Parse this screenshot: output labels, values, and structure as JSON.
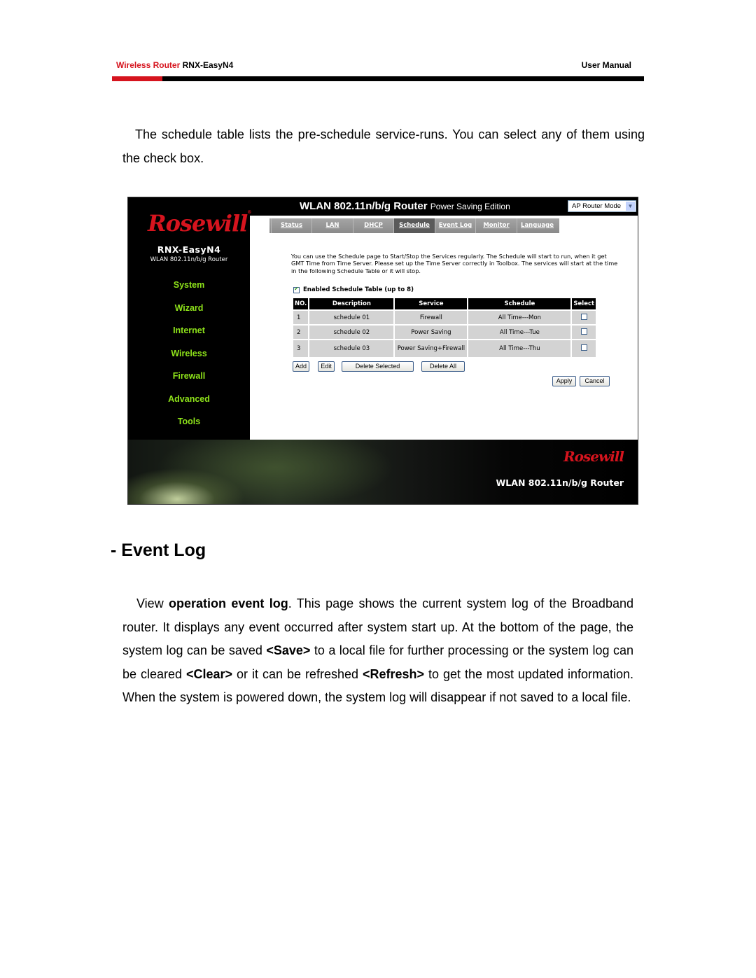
{
  "header": {
    "product_label": "Wireless Router",
    "model": "RNX-EasyN4",
    "doc_type": "User Manual",
    "accent_color": "#d6141e"
  },
  "intro_paragraph": "The schedule table lists the pre-schedule service-runs. You can select any of them using the check box.",
  "router_ui": {
    "title_main": "WLAN 802.11n/b/g Router",
    "title_sub": "Power Saving Edition",
    "mode_select": {
      "selected": "AP Router Mode"
    },
    "brand": "Rosewill",
    "model_name": "RNX-EasyN4",
    "model_desc": "WLAN 802.11n/b/g Router",
    "nav_color": "#8ee31a",
    "sidebar": [
      {
        "label": "System"
      },
      {
        "label": "Wizard"
      },
      {
        "label": "Internet"
      },
      {
        "label": "Wireless"
      },
      {
        "label": "Firewall"
      },
      {
        "label": "Advanced"
      },
      {
        "label": "Tools"
      }
    ],
    "tabs": [
      {
        "label": "Status",
        "active": false
      },
      {
        "label": "LAN",
        "active": false
      },
      {
        "label": "DHCP",
        "active": false
      },
      {
        "label": "Schedule",
        "active": true
      },
      {
        "label": "Event Log",
        "active": false
      },
      {
        "label": "Monitor",
        "active": false
      },
      {
        "label": "Language",
        "active": false
      }
    ],
    "intro_text": "You can use the Schedule page to Start/Stop the Services regularly. The Schedule will start to run, when it get GMT Time from Time Server. Please set up the Time Server correctly in Toolbox. The services will start at the time in the following Schedule Table or it will stop.",
    "enable_label": "Enabled Schedule Table (up to 8)",
    "enable_checked": true,
    "table": {
      "columns": [
        "NO.",
        "Description",
        "Service",
        "Schedule",
        "Select"
      ],
      "rows": [
        {
          "no": "1",
          "description": "schedule 01",
          "service": "Firewall",
          "schedule": "All Time---Mon",
          "selected": false
        },
        {
          "no": "2",
          "description": "schedule 02",
          "service": "Power Saving",
          "schedule": "All Time---Tue",
          "selected": false
        },
        {
          "no": "3",
          "description": "schedule 03",
          "service": "Power Saving+Firewall",
          "schedule": "All Time---Thu",
          "selected": false
        }
      ]
    },
    "buttons": {
      "add": "Add",
      "edit": "Edit",
      "delete_selected": "Delete Selected",
      "delete_all": "Delete All",
      "apply": "Apply",
      "cancel": "Cancel"
    },
    "footer": {
      "brand": "Rosewill",
      "title": "WLAN 802.11n/b/g Router"
    }
  },
  "section": {
    "heading": "- Event Log",
    "paragraph_parts": {
      "t1": "View ",
      "b1": "operation event log",
      "t2": ". This page shows the current system log of the Broadband router. It displays any event occurred after system start up. At the bottom of the page, the system log can be saved ",
      "b2": "<Save>",
      "t3": " to a local file for further processing or the system log can be cleared ",
      "b3": "<Clear>",
      "t4": " or it can be refreshed ",
      "b4": "<Refresh>",
      "t5": " to get the most updated information. When the system is powered down, the system log will disappear if not saved to a local file."
    }
  }
}
